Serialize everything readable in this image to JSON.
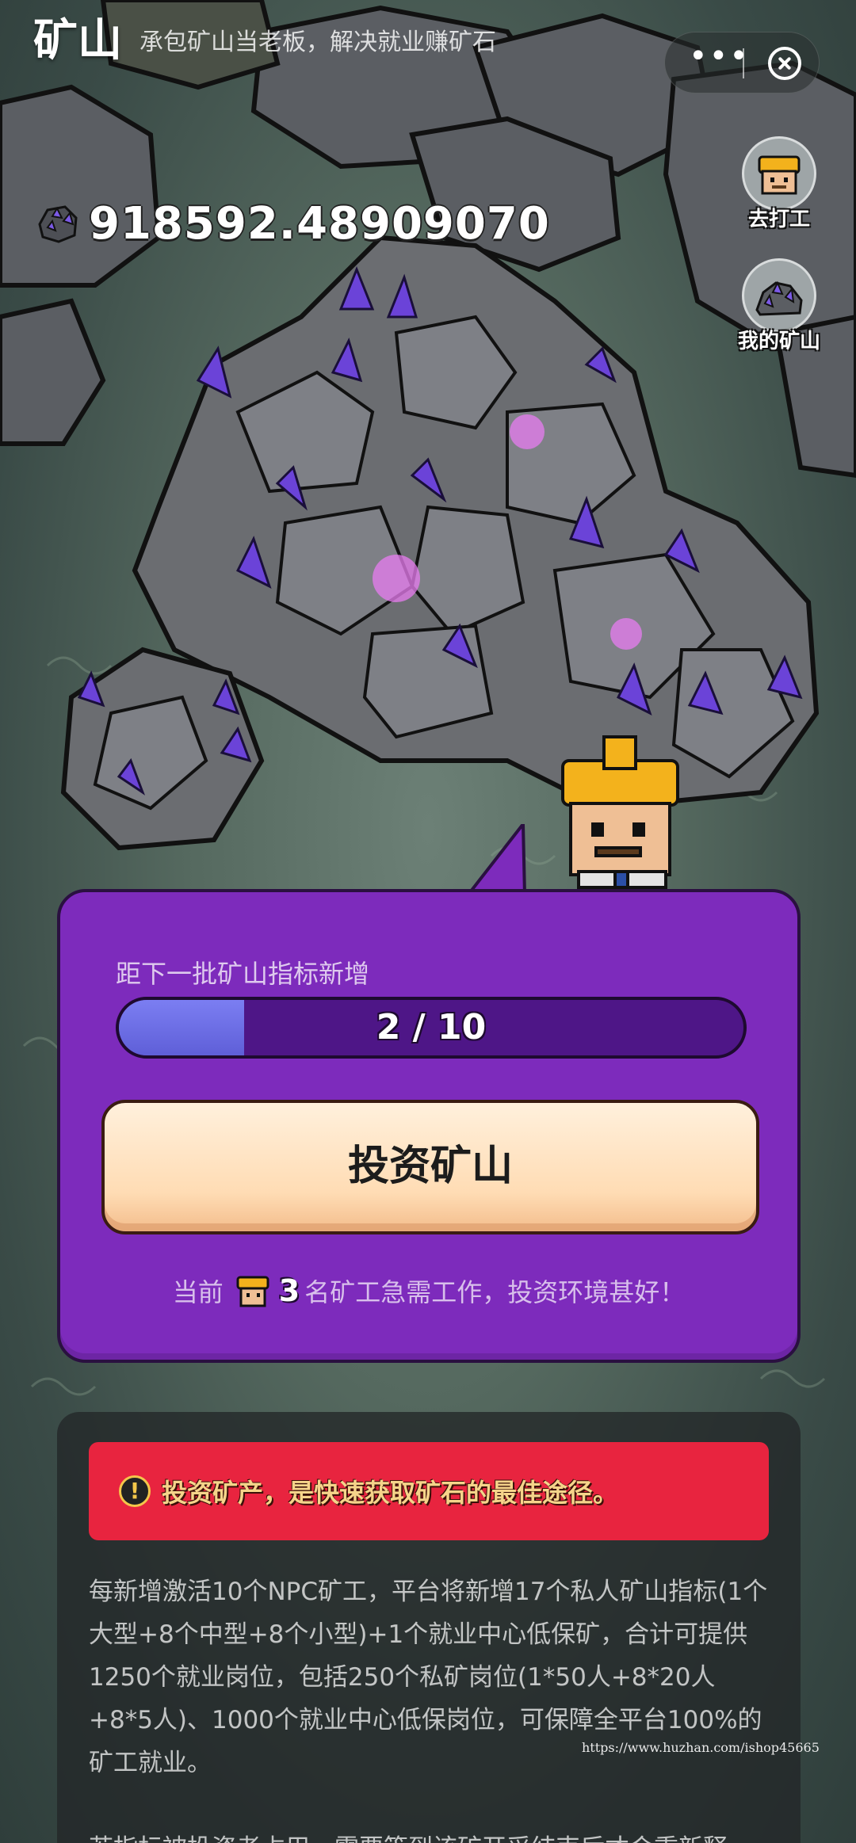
{
  "header": {
    "title": "矿山",
    "subtitle": "承包矿山当老板，解决就业赚矿石"
  },
  "balance": {
    "amount": "918592.48909070",
    "icon": "ore-gem-icon"
  },
  "side_buttons": [
    {
      "label": "去打工",
      "icon": "miner-helmet-icon"
    },
    {
      "label": "我的矿山",
      "icon": "mine-rock-icon"
    }
  ],
  "panel": {
    "hint": "距下一批矿山指标新增",
    "progress": {
      "current": 2,
      "total": 10,
      "text": "2 / 10"
    },
    "invest_button": "投资矿山",
    "status": {
      "prefix": "当前",
      "count": "3",
      "suffix": "名矿工急需工作，投资环境甚好！"
    }
  },
  "info": {
    "alert": "投资矿产，是快速获取矿石的最佳途径。",
    "paragraphs": [
      "每新增激活10个NPC矿工，平台将新增17个私人矿山指标(1个大型+8个中型+8个小型)+1个就业中心低保矿，合计可提供1250个就业岗位，包括250个私矿岗位(1*50人+8*20人+8*5人)、1000个就业中心低保岗位，可保障全平台100%的矿工就业。",
      "若指标被投资者占用，需要等到该矿开采结束后才会重新释"
    ]
  },
  "watermark": "https://www.huzhan.com/ishop45665",
  "colors": {
    "panel": "#7d2bbc",
    "progress_fill": "#6c6fe6",
    "button": "#ffe0bd",
    "alert": "#e8243f"
  }
}
